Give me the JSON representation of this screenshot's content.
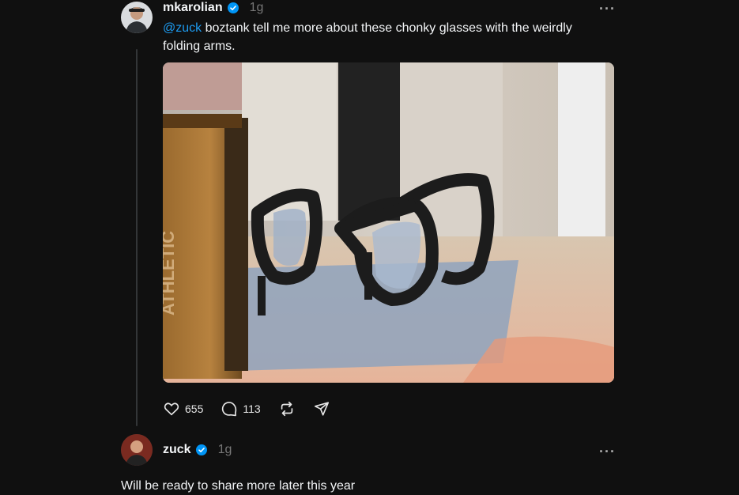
{
  "post": {
    "username": "mkarolian",
    "time": "1g",
    "mention": "@zuck",
    "text": " boztank tell me more about these chonky glasses with the weirdly folding arms.",
    "image_alt": "Photo of chunky black glasses on a table",
    "likes": "655",
    "comments": "113"
  },
  "reply": {
    "username": "zuck",
    "time": "1g",
    "text": "Will be ready to share more later this year"
  },
  "icons": {
    "verified": "verified-badge-icon",
    "like": "heart-icon",
    "comment": "comment-icon",
    "repost": "repost-icon",
    "share": "share-icon",
    "more": "more-icon"
  },
  "colors": {
    "background": "#101010",
    "text": "#f3f5f7",
    "muted": "#777777",
    "mention": "#1d9bf0",
    "verified": "#0095f6"
  }
}
